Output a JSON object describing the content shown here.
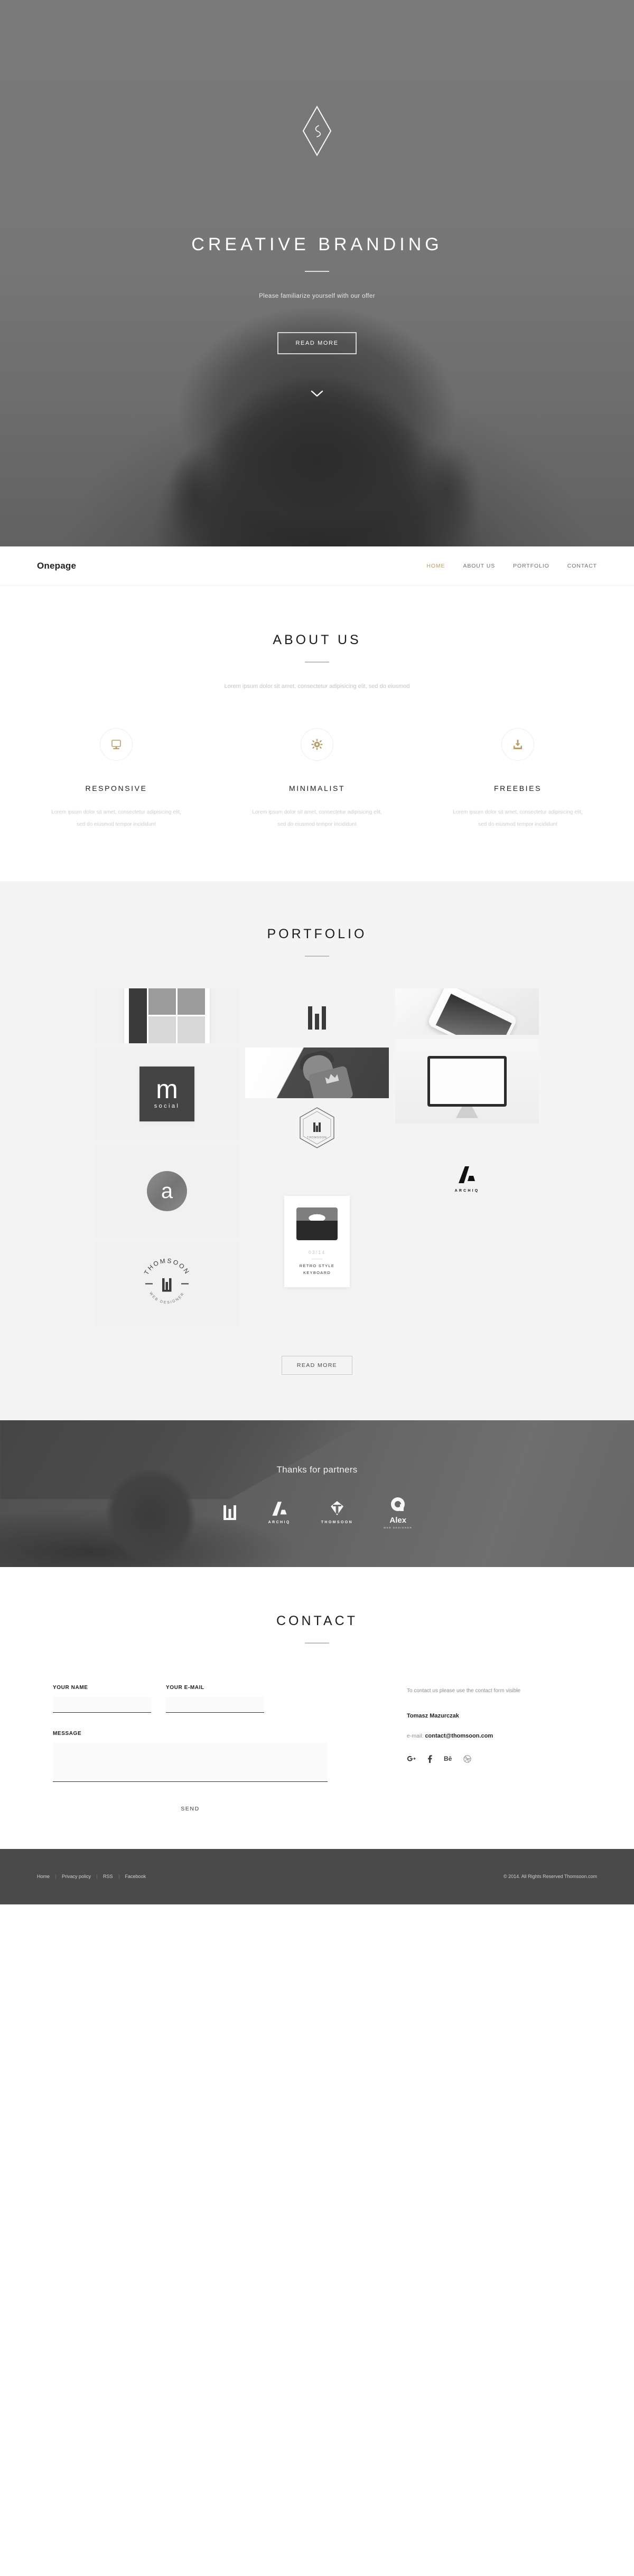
{
  "hero": {
    "logo_icon": "diamond-monogram-icon",
    "title": "CREATIVE BRANDING",
    "subtitle": "Please familiarize yourself with our offer",
    "cta_label": "READ MORE",
    "scroll_icon": "chevron-down-icon"
  },
  "nav": {
    "brand": "Onepage",
    "links": [
      {
        "label": "HOME",
        "active": true
      },
      {
        "label": "ABOUT US",
        "active": false
      },
      {
        "label": "PORTFOLIO",
        "active": false
      },
      {
        "label": "CONTACT",
        "active": false
      }
    ]
  },
  "about": {
    "title": "ABOUT US",
    "lead": "Lorem ipsum dolor sit amet, consectetur adipisicing elit, sed do eiusmod",
    "features": [
      {
        "icon": "monitor-icon",
        "title": "RESPONSIVE",
        "text": "Lorem ipsum dolor sit amet, consectetur adipisicing elit, sed do eiusmod tempor incididunt"
      },
      {
        "icon": "gear-icon",
        "title": "MINIMALIST",
        "text": "Lorem ipsum dolor sit amet, consectetur adipisicing elit, sed do eiusmod tempor incididunt"
      },
      {
        "icon": "download-icon",
        "title": "FREEBIES",
        "text": "Lorem ipsum dolor sit amet, consectetur adipisicing elit, sed do eiusmod tempor incididunt"
      }
    ]
  },
  "portfolio": {
    "title": "PORTFOLIO",
    "items": [
      {
        "name": "tablet-mockup",
        "caption": ""
      },
      {
        "name": "thomsoon-logo-mark",
        "caption": ""
      },
      {
        "name": "phone-app-mockup",
        "caption": ""
      },
      {
        "name": "m-social-logo",
        "caption": "m",
        "caption2": "social"
      },
      {
        "name": "robot-illustration",
        "caption": ""
      },
      {
        "name": "imac-website-mockup",
        "caption": ""
      },
      {
        "name": "hex-badge-logo",
        "caption": ""
      },
      {
        "name": "circle-a-logo",
        "caption": "a"
      },
      {
        "name": "retro-keyboard-poster",
        "caption": "03/14",
        "caption2": "RETRO STYLE KEYBOARD"
      },
      {
        "name": "thomsoon-round-badge",
        "caption": "THOMSOON",
        "caption2": "WEB DESIGNER"
      },
      {
        "name": "archiq-logo",
        "caption": "ARCHIQ"
      }
    ],
    "cta_label": "READ MORE"
  },
  "partners": {
    "title": "Thanks for partners",
    "logos": [
      {
        "name": "thomsoon-bars-logo",
        "label": ""
      },
      {
        "name": "archiq-logo",
        "label": "ARCHIQ"
      },
      {
        "name": "thomsoon-diamond-logo",
        "label": "THOMSOON"
      },
      {
        "name": "alex-logo",
        "label": "Alex",
        "sublabel": "WEB DESIGNER"
      }
    ]
  },
  "contact": {
    "title": "CONTACT",
    "form": {
      "name_label": "YOUR NAME",
      "name_value": "",
      "name_placeholder": "",
      "email_label": "YOUR E-MAIL",
      "email_value": "",
      "email_placeholder": "",
      "message_label": "MESSAGE",
      "message_value": "",
      "message_placeholder": "",
      "send_label": "SEND"
    },
    "info": {
      "note": "To contact us please use the contact form visible",
      "person": "Tomasz Mazurczak",
      "email_prefix": "e-mail:",
      "email": "contact@thomsoon.com",
      "socials": [
        {
          "icon": "google-plus-icon",
          "glyph": "g+"
        },
        {
          "icon": "facebook-icon",
          "glyph": "f"
        },
        {
          "icon": "behance-icon",
          "glyph": "Bē"
        },
        {
          "icon": "dribbble-icon",
          "glyph": "◉"
        }
      ]
    }
  },
  "footer": {
    "links": [
      "Home",
      "Privacy policy",
      "RSS",
      "Facebook"
    ],
    "copyright": "© 2014. All Rights Reserved Thomsoon.com"
  },
  "colors": {
    "accent": "#b9a06a",
    "dark": "#4a4a4a",
    "gray_bg": "#f4f4f4"
  }
}
